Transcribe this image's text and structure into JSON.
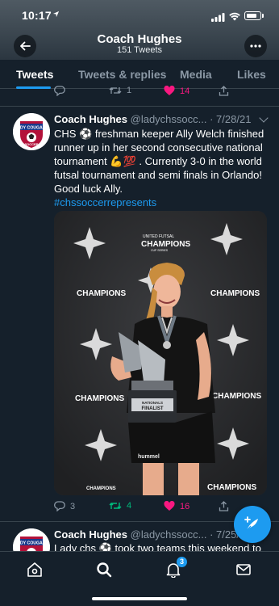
{
  "status_bar": {
    "time": "10:17"
  },
  "header": {
    "title": "Coach Hughes",
    "subtitle": "151 Tweets"
  },
  "tabs": [
    {
      "label": "Tweets",
      "active": true
    },
    {
      "label": "Tweets & replies",
      "active": false
    },
    {
      "label": "Media",
      "active": false
    },
    {
      "label": "Likes",
      "active": false
    }
  ],
  "prev_tweet": {
    "retweets": "1",
    "likes": "14"
  },
  "tweet": {
    "name": "Coach Hughes",
    "handle": "@ladychssocc...",
    "date": "· 7/28/21",
    "text_1": "CHS ",
    "text_2": " freshman keeper Ally Welch finished runner up in her second consecutive national tournament ",
    "text_3": " .   Currently 3-0 in the world futsal tournament and semi finals in Orlando!   Good luck Ally.",
    "hashtag": "#chssoccerrepresents",
    "emoji_ball": "⚽",
    "emoji_muscle": "💪",
    "emoji_hundred": "💯",
    "avatar_text_top": "LADY COUGARS",
    "avatar_text_bottom": "SOCCER",
    "media": {
      "brand_top": "UNITED FUTSAL",
      "brand_main": "CHAMPIONS",
      "brand_sub": "CUP SERIES",
      "trophy_plate_1": "NATIONALS",
      "trophy_plate_2": "FINALIST",
      "shorts_brand": "hummel"
    },
    "replies": "3",
    "retweets": "4",
    "likes": "16"
  },
  "next_tweet": {
    "name": "Coach Hughes",
    "handle": "@ladychssocc...",
    "date": "· 7/25/",
    "text_1": "Lady chs ",
    "text_2": " took two teams this weekend to"
  },
  "nav": {
    "notifications_badge": "3"
  },
  "colors": {
    "accent": "#1d9bf0",
    "like": "#f91880",
    "retweet": "#00ba7c",
    "background": "#15202b"
  }
}
